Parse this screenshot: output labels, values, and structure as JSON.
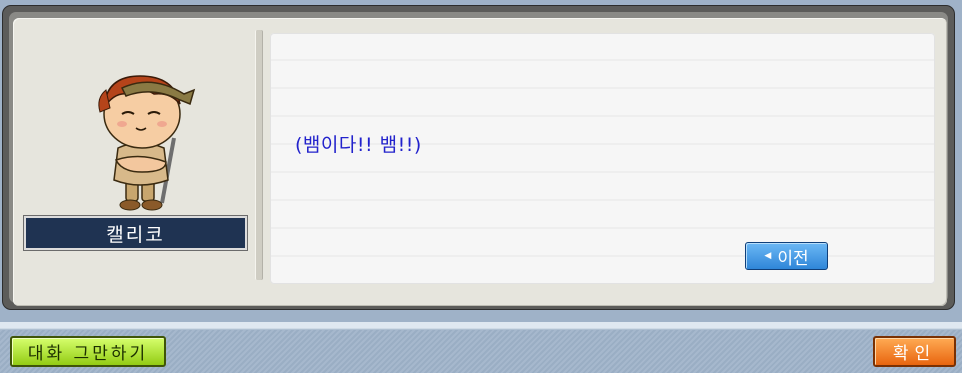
{
  "npc": {
    "name": "캘리코"
  },
  "dialog": {
    "text": "(뱀이다!! 뱀!!)",
    "prev_label": "이전",
    "prev_icon": "left-triangle-icon"
  },
  "footer": {
    "end_chat_label": "대화 그만하기",
    "ok_label": "확인"
  }
}
